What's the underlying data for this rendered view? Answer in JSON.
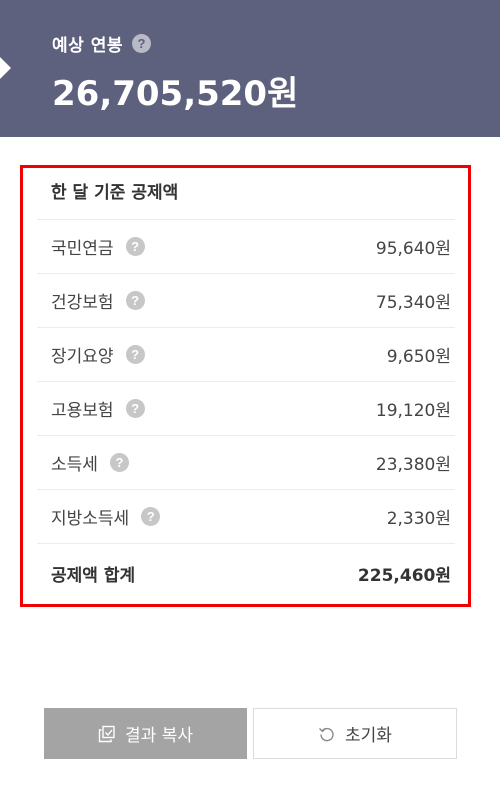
{
  "header": {
    "label": "예상 연봉",
    "amount": "26,705,520원",
    "help_icon": "question-circle-icon"
  },
  "deductions": {
    "title": "한 달 기준 공제액",
    "items": [
      {
        "label": "국민연금",
        "value": "95,640원"
      },
      {
        "label": "건강보험",
        "value": "75,340원"
      },
      {
        "label": "장기요양",
        "value": "9,650원"
      },
      {
        "label": "고용보험",
        "value": "19,120원"
      },
      {
        "label": "소득세",
        "value": "23,380원"
      },
      {
        "label": "지방소득세",
        "value": "2,330원"
      }
    ],
    "total_label": "공제액 합계",
    "total_value": "225,460원",
    "highlight_color": "#f00000"
  },
  "buttons": {
    "copy_label": "결과 복사",
    "copy_icon": "copy-icon",
    "reset_label": "초기화",
    "reset_icon": "refresh-icon"
  },
  "colors": {
    "header_bg": "#5d617e",
    "copy_button_bg": "#a4a4a4"
  }
}
